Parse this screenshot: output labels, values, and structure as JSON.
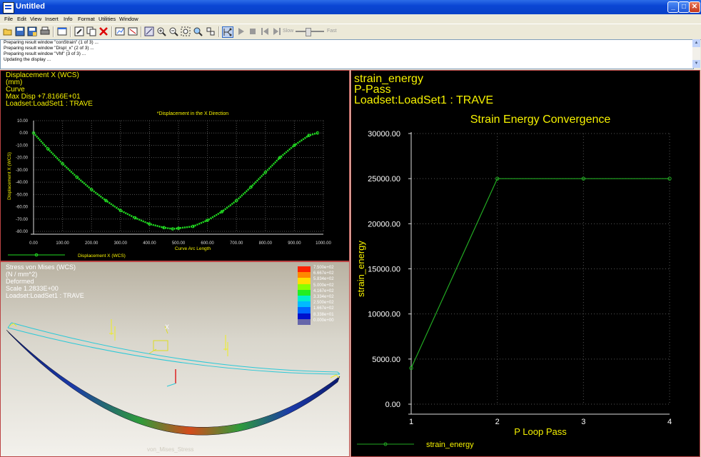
{
  "window": {
    "title": "Untitled",
    "minimize": "_",
    "maximize": "□",
    "close": "✕"
  },
  "menu": [
    "File",
    "Edit",
    "View",
    "Insert",
    "Info",
    "Format",
    "Utilities",
    "Window"
  ],
  "toolbar": {
    "slow_label": "Slow",
    "fast_label": "Fast",
    "speed_level": 0.4,
    "icons": [
      "open-icon",
      "save-icon",
      "save-as-icon",
      "print-icon",
      "copy-window-icon",
      "edit-icon",
      "copy-icon",
      "delete-icon",
      "window-icon-1",
      "window-icon-2",
      "refit-icon",
      "zoom-in-icon",
      "zoom-out-icon",
      "zoom-window-icon",
      "pan-icon",
      "spin-icon",
      "animation-icon",
      "play-icon",
      "stop-icon",
      "step-back-icon",
      "step-forward-icon"
    ]
  },
  "messages": [
    "Preparing result window \"conStrain\" (1 of 3) ...",
    "Preparing result window \"Displ_x\" (2 of 3) ...",
    "Preparing result window \"VM\" (3 of 3) ...",
    "Updating the display ..."
  ],
  "pane_displacement": {
    "info": [
      "Displacement X (WCS)",
      "(mm)",
      "Curve",
      "Max Disp  +7.8166E+01",
      "Loadset:LoadSet1 :  TRAVE"
    ],
    "chart_data": {
      "type": "line",
      "title": "*Displacement in the X Direction",
      "xlabel": "Curve Arc Length",
      "ylabel": "Displacement X (WCS)",
      "xlim": [
        0,
        1000
      ],
      "ylim": [
        -80,
        10
      ],
      "xticks": [
        "0.00",
        "100.00",
        "200.00",
        "300.00",
        "400.00",
        "500.00",
        "600.00",
        "700.00",
        "800.00",
        "900.00",
        "1000.00"
      ],
      "yticks": [
        "10.00",
        "0.00",
        "-10.00",
        "-20.00",
        "-30.00",
        "-40.00",
        "-50.00",
        "-60.00",
        "-70.00",
        "-80.00"
      ],
      "series": [
        {
          "name": "Displacement X (WCS)",
          "x": [
            0,
            50,
            100,
            150,
            200,
            250,
            300,
            350,
            400,
            450,
            480,
            500,
            550,
            600,
            650,
            700,
            750,
            800,
            850,
            900,
            950,
            980
          ],
          "y": [
            0,
            -13,
            -25,
            -36,
            -46,
            -55,
            -63,
            -69,
            -74,
            -77,
            -78,
            -77.5,
            -76,
            -71,
            -64,
            -55,
            -44,
            -32,
            -20,
            -10,
            -2,
            0
          ]
        }
      ],
      "grid": true,
      "legend": "bottom-left",
      "color": "#22dd22"
    }
  },
  "pane_vonmises": {
    "info": [
      "Stress von Mises (WCS)",
      "(N / mm^2)",
      "Deformed",
      "Scale  1.2833E+00",
      "Loadset:LoadSet1 :  TRAVE"
    ],
    "legend_values": [
      "7.500e+02",
      "6.667e+02",
      "5.834e+02",
      "5.000e+02",
      "4.167e+02",
      "3.334e+02",
      "2.500e+02",
      "1.667e+02",
      "8.338e+01",
      "0.000e+00"
    ],
    "legend_colors": [
      "#ff2200",
      "#ff8800",
      "#ffdd00",
      "#88ff00",
      "#22ee22",
      "#00eecc",
      "#00bbff",
      "#0066ff",
      "#0011cc",
      "#6666aa"
    ],
    "footer": "von_Mises_Stress"
  },
  "pane_strain": {
    "info": [
      "strain_energy",
      "P-Pass",
      "Loadset:LoadSet1 :  TRAVE"
    ],
    "chart_data": {
      "type": "line",
      "title": "Strain Energy Convergence",
      "xlabel": "P Loop Pass",
      "ylabel": "strain_energy",
      "x": [
        1,
        2,
        3,
        4
      ],
      "xticks": [
        "1",
        "2",
        "3",
        "4"
      ],
      "ylim": [
        0,
        30000
      ],
      "yticks": [
        "30000.00",
        "25000.00",
        "20000.00",
        "15000.00",
        "10000.00",
        "5000.00",
        "0.00"
      ],
      "series": [
        {
          "name": "strain_energy",
          "values": [
            4000,
            25000,
            25000,
            25000
          ]
        }
      ],
      "grid": true,
      "legend": "bottom-left",
      "color": "#22aa22"
    }
  }
}
